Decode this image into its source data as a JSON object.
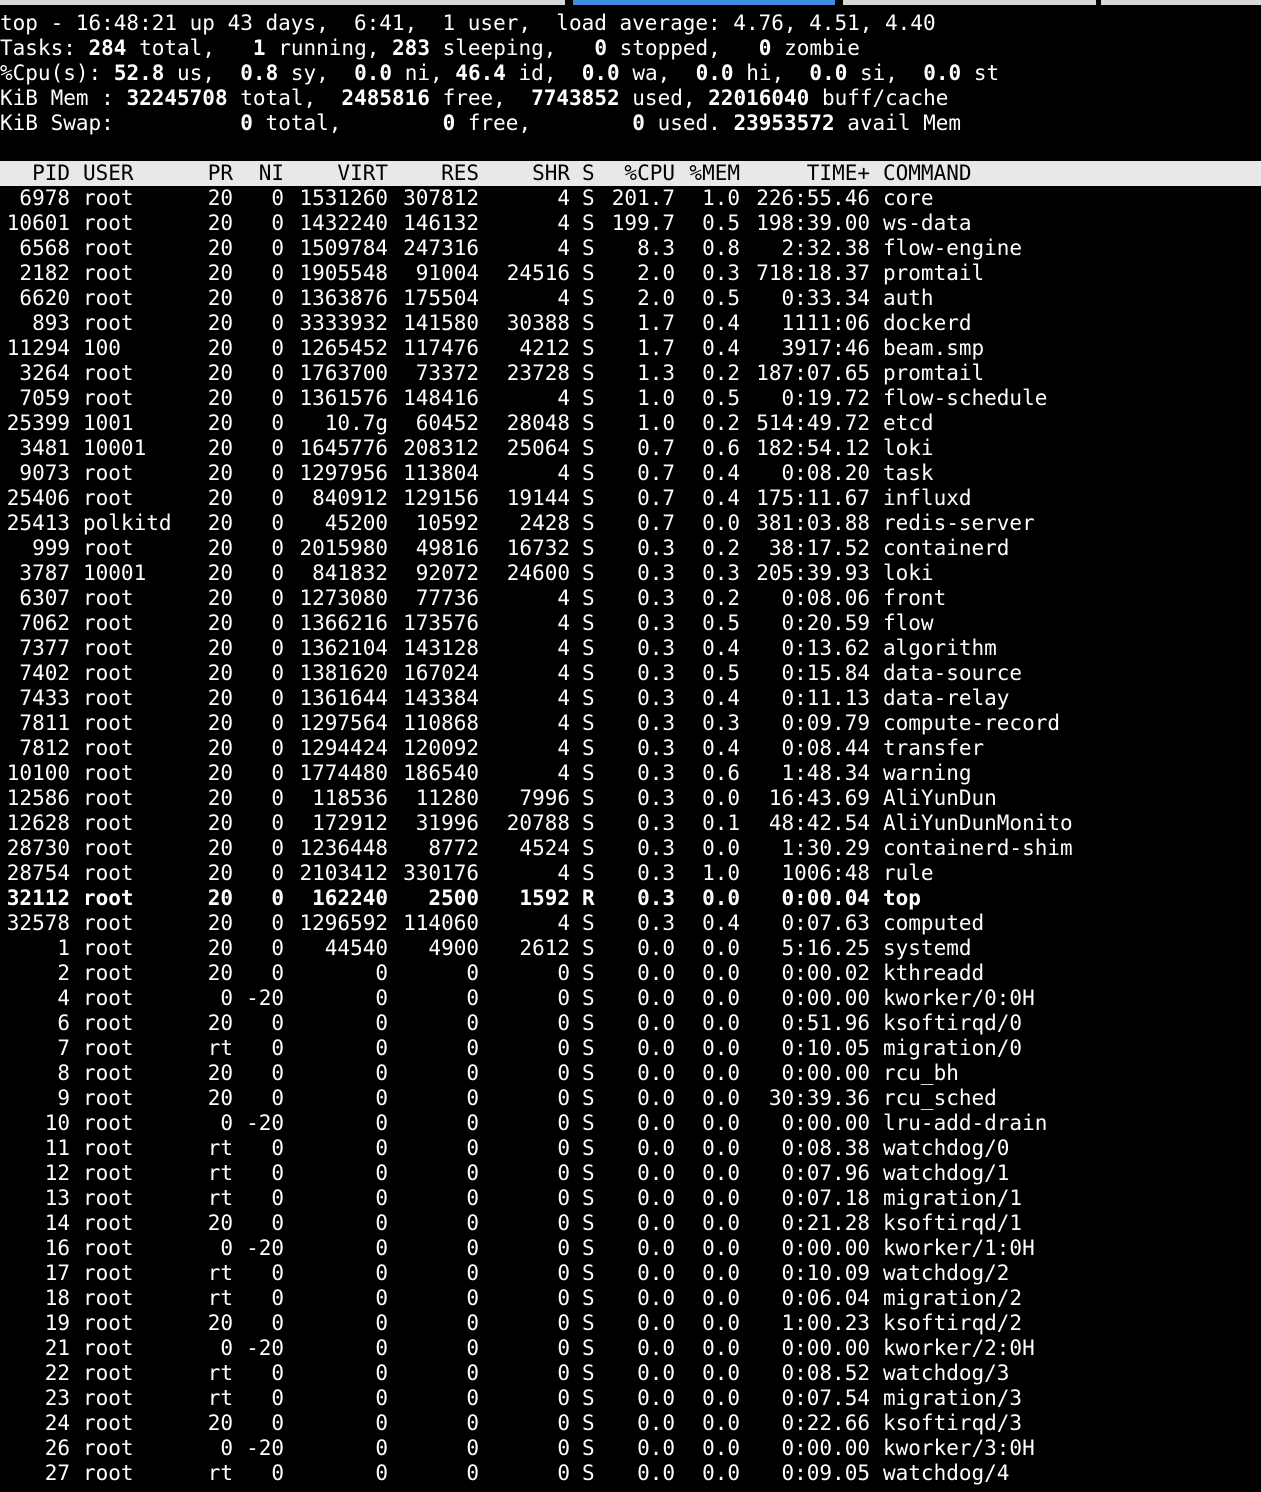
{
  "summary": {
    "uptime_line": "top - 16:48:21 up 43 days,  6:41,  1 user,  load average: 4.76, 4.51, 4.40",
    "tasks": {
      "label": "Tasks:",
      "total": "284",
      "total_lbl": "total,",
      "running": "1",
      "running_lbl": "running,",
      "sleeping": "283",
      "sleeping_lbl": "sleeping,",
      "stopped": "0",
      "stopped_lbl": "stopped,",
      "zombie": "0",
      "zombie_lbl": "zombie"
    },
    "cpu": {
      "label": "%Cpu(s):",
      "us": "52.8",
      "us_lbl": "us,",
      "sy": "0.8",
      "sy_lbl": "sy,",
      "ni": "0.0",
      "ni_lbl": "ni,",
      "id": "46.4",
      "id_lbl": "id,",
      "wa": "0.0",
      "wa_lbl": "wa,",
      "hi": "0.0",
      "hi_lbl": "hi,",
      "si": "0.0",
      "si_lbl": "si,",
      "st": "0.0",
      "st_lbl": "st"
    },
    "mem": {
      "label": "KiB Mem :",
      "total": "32245708",
      "total_lbl": "total,",
      "free": "2485816",
      "free_lbl": "free,",
      "used": "7743852",
      "used_lbl": "used,",
      "buff": "22016040",
      "buff_lbl": "buff/cache"
    },
    "swap": {
      "label": "KiB Swap:",
      "total": "0",
      "total_lbl": "total,",
      "free": "0",
      "free_lbl": "free,",
      "used": "0",
      "used_lbl": "used.",
      "avail": "23953572",
      "avail_lbl": "avail Mem"
    }
  },
  "columns": [
    "PID",
    "USER",
    "PR",
    "NI",
    "VIRT",
    "RES",
    "SHR",
    "S",
    "%CPU",
    "%MEM",
    "TIME+",
    "COMMAND"
  ],
  "processes": [
    [
      "6978",
      "root",
      "20",
      "0",
      "1531260",
      "307812",
      "4",
      "S",
      "201.7",
      "1.0",
      "226:55.46",
      "core"
    ],
    [
      "10601",
      "root",
      "20",
      "0",
      "1432240",
      "146132",
      "4",
      "S",
      "199.7",
      "0.5",
      "198:39.00",
      "ws-data"
    ],
    [
      "6568",
      "root",
      "20",
      "0",
      "1509784",
      "247316",
      "4",
      "S",
      "8.3",
      "0.8",
      "2:32.38",
      "flow-engine"
    ],
    [
      "2182",
      "root",
      "20",
      "0",
      "1905548",
      "91004",
      "24516",
      "S",
      "2.0",
      "0.3",
      "718:18.37",
      "promtail"
    ],
    [
      "6620",
      "root",
      "20",
      "0",
      "1363876",
      "175504",
      "4",
      "S",
      "2.0",
      "0.5",
      "0:33.34",
      "auth"
    ],
    [
      "893",
      "root",
      "20",
      "0",
      "3333932",
      "141580",
      "30388",
      "S",
      "1.7",
      "0.4",
      "1111:06",
      "dockerd"
    ],
    [
      "11294",
      "100",
      "20",
      "0",
      "1265452",
      "117476",
      "4212",
      "S",
      "1.7",
      "0.4",
      "3917:46",
      "beam.smp"
    ],
    [
      "3264",
      "root",
      "20",
      "0",
      "1763700",
      "73372",
      "23728",
      "S",
      "1.3",
      "0.2",
      "187:07.65",
      "promtail"
    ],
    [
      "7059",
      "root",
      "20",
      "0",
      "1361576",
      "148416",
      "4",
      "S",
      "1.0",
      "0.5",
      "0:19.72",
      "flow-schedule"
    ],
    [
      "25399",
      "1001",
      "20",
      "0",
      "10.7g",
      "60452",
      "28048",
      "S",
      "1.0",
      "0.2",
      "514:49.72",
      "etcd"
    ],
    [
      "3481",
      "10001",
      "20",
      "0",
      "1645776",
      "208312",
      "25064",
      "S",
      "0.7",
      "0.6",
      "182:54.12",
      "loki"
    ],
    [
      "9073",
      "root",
      "20",
      "0",
      "1297956",
      "113804",
      "4",
      "S",
      "0.7",
      "0.4",
      "0:08.20",
      "task"
    ],
    [
      "25406",
      "root",
      "20",
      "0",
      "840912",
      "129156",
      "19144",
      "S",
      "0.7",
      "0.4",
      "175:11.67",
      "influxd"
    ],
    [
      "25413",
      "polkitd",
      "20",
      "0",
      "45200",
      "10592",
      "2428",
      "S",
      "0.7",
      "0.0",
      "381:03.88",
      "redis-server"
    ],
    [
      "999",
      "root",
      "20",
      "0",
      "2015980",
      "49816",
      "16732",
      "S",
      "0.3",
      "0.2",
      "38:17.52",
      "containerd"
    ],
    [
      "3787",
      "10001",
      "20",
      "0",
      "841832",
      "92072",
      "24600",
      "S",
      "0.3",
      "0.3",
      "205:39.93",
      "loki"
    ],
    [
      "6307",
      "root",
      "20",
      "0",
      "1273080",
      "77736",
      "4",
      "S",
      "0.3",
      "0.2",
      "0:08.06",
      "front"
    ],
    [
      "7062",
      "root",
      "20",
      "0",
      "1366216",
      "173576",
      "4",
      "S",
      "0.3",
      "0.5",
      "0:20.59",
      "flow"
    ],
    [
      "7377",
      "root",
      "20",
      "0",
      "1362104",
      "143128",
      "4",
      "S",
      "0.3",
      "0.4",
      "0:13.62",
      "algorithm"
    ],
    [
      "7402",
      "root",
      "20",
      "0",
      "1381620",
      "167024",
      "4",
      "S",
      "0.3",
      "0.5",
      "0:15.84",
      "data-source"
    ],
    [
      "7433",
      "root",
      "20",
      "0",
      "1361644",
      "143384",
      "4",
      "S",
      "0.3",
      "0.4",
      "0:11.13",
      "data-relay"
    ],
    [
      "7811",
      "root",
      "20",
      "0",
      "1297564",
      "110868",
      "4",
      "S",
      "0.3",
      "0.3",
      "0:09.79",
      "compute-record"
    ],
    [
      "7812",
      "root",
      "20",
      "0",
      "1294424",
      "120092",
      "4",
      "S",
      "0.3",
      "0.4",
      "0:08.44",
      "transfer"
    ],
    [
      "10100",
      "root",
      "20",
      "0",
      "1774480",
      "186540",
      "4",
      "S",
      "0.3",
      "0.6",
      "1:48.34",
      "warning"
    ],
    [
      "12586",
      "root",
      "20",
      "0",
      "118536",
      "11280",
      "7996",
      "S",
      "0.3",
      "0.0",
      "16:43.69",
      "AliYunDun"
    ],
    [
      "12628",
      "root",
      "20",
      "0",
      "172912",
      "31996",
      "20788",
      "S",
      "0.3",
      "0.1",
      "48:42.54",
      "AliYunDunMonito"
    ],
    [
      "28730",
      "root",
      "20",
      "0",
      "1236448",
      "8772",
      "4524",
      "S",
      "0.3",
      "0.0",
      "1:30.29",
      "containerd-shim"
    ],
    [
      "28754",
      "root",
      "20",
      "0",
      "2103412",
      "330176",
      "4",
      "S",
      "0.3",
      "1.0",
      "1006:48",
      "rule"
    ],
    [
      "32112",
      "root",
      "20",
      "0",
      "162240",
      "2500",
      "1592",
      "R",
      "0.3",
      "0.0",
      "0:00.04",
      "top"
    ],
    [
      "32578",
      "root",
      "20",
      "0",
      "1296592",
      "114060",
      "4",
      "S",
      "0.3",
      "0.4",
      "0:07.63",
      "computed"
    ],
    [
      "1",
      "root",
      "20",
      "0",
      "44540",
      "4900",
      "2612",
      "S",
      "0.0",
      "0.0",
      "5:16.25",
      "systemd"
    ],
    [
      "2",
      "root",
      "20",
      "0",
      "0",
      "0",
      "0",
      "S",
      "0.0",
      "0.0",
      "0:00.02",
      "kthreadd"
    ],
    [
      "4",
      "root",
      "0",
      "-20",
      "0",
      "0",
      "0",
      "S",
      "0.0",
      "0.0",
      "0:00.00",
      "kworker/0:0H"
    ],
    [
      "6",
      "root",
      "20",
      "0",
      "0",
      "0",
      "0",
      "S",
      "0.0",
      "0.0",
      "0:51.96",
      "ksoftirqd/0"
    ],
    [
      "7",
      "root",
      "rt",
      "0",
      "0",
      "0",
      "0",
      "S",
      "0.0",
      "0.0",
      "0:10.05",
      "migration/0"
    ],
    [
      "8",
      "root",
      "20",
      "0",
      "0",
      "0",
      "0",
      "S",
      "0.0",
      "0.0",
      "0:00.00",
      "rcu_bh"
    ],
    [
      "9",
      "root",
      "20",
      "0",
      "0",
      "0",
      "0",
      "S",
      "0.0",
      "0.0",
      "30:39.36",
      "rcu_sched"
    ],
    [
      "10",
      "root",
      "0",
      "-20",
      "0",
      "0",
      "0",
      "S",
      "0.0",
      "0.0",
      "0:00.00",
      "lru-add-drain"
    ],
    [
      "11",
      "root",
      "rt",
      "0",
      "0",
      "0",
      "0",
      "S",
      "0.0",
      "0.0",
      "0:08.38",
      "watchdog/0"
    ],
    [
      "12",
      "root",
      "rt",
      "0",
      "0",
      "0",
      "0",
      "S",
      "0.0",
      "0.0",
      "0:07.96",
      "watchdog/1"
    ],
    [
      "13",
      "root",
      "rt",
      "0",
      "0",
      "0",
      "0",
      "S",
      "0.0",
      "0.0",
      "0:07.18",
      "migration/1"
    ],
    [
      "14",
      "root",
      "20",
      "0",
      "0",
      "0",
      "0",
      "S",
      "0.0",
      "0.0",
      "0:21.28",
      "ksoftirqd/1"
    ],
    [
      "16",
      "root",
      "0",
      "-20",
      "0",
      "0",
      "0",
      "S",
      "0.0",
      "0.0",
      "0:00.00",
      "kworker/1:0H"
    ],
    [
      "17",
      "root",
      "rt",
      "0",
      "0",
      "0",
      "0",
      "S",
      "0.0",
      "0.0",
      "0:10.09",
      "watchdog/2"
    ],
    [
      "18",
      "root",
      "rt",
      "0",
      "0",
      "0",
      "0",
      "S",
      "0.0",
      "0.0",
      "0:06.04",
      "migration/2"
    ],
    [
      "19",
      "root",
      "20",
      "0",
      "0",
      "0",
      "0",
      "S",
      "0.0",
      "0.0",
      "1:00.23",
      "ksoftirqd/2"
    ],
    [
      "21",
      "root",
      "0",
      "-20",
      "0",
      "0",
      "0",
      "S",
      "0.0",
      "0.0",
      "0:00.00",
      "kworker/2:0H"
    ],
    [
      "22",
      "root",
      "rt",
      "0",
      "0",
      "0",
      "0",
      "S",
      "0.0",
      "0.0",
      "0:08.52",
      "watchdog/3"
    ],
    [
      "23",
      "root",
      "rt",
      "0",
      "0",
      "0",
      "0",
      "S",
      "0.0",
      "0.0",
      "0:07.54",
      "migration/3"
    ],
    [
      "24",
      "root",
      "20",
      "0",
      "0",
      "0",
      "0",
      "S",
      "0.0",
      "0.0",
      "0:22.66",
      "ksoftirqd/3"
    ],
    [
      "26",
      "root",
      "0",
      "-20",
      "0",
      "0",
      "0",
      "S",
      "0.0",
      "0.0",
      "0:00.00",
      "kworker/3:0H"
    ],
    [
      "27",
      "root",
      "rt",
      "0",
      "0",
      "0",
      "0",
      "S",
      "0.0",
      "0.0",
      "0:09.05",
      "watchdog/4"
    ]
  ],
  "highlighted_pid": "32112",
  "colors": {
    "background": "#000000",
    "text": "#ffffff",
    "header_bg": "#e8e8e8",
    "header_text": "#000000",
    "active_tab": "#3d8fe0"
  }
}
